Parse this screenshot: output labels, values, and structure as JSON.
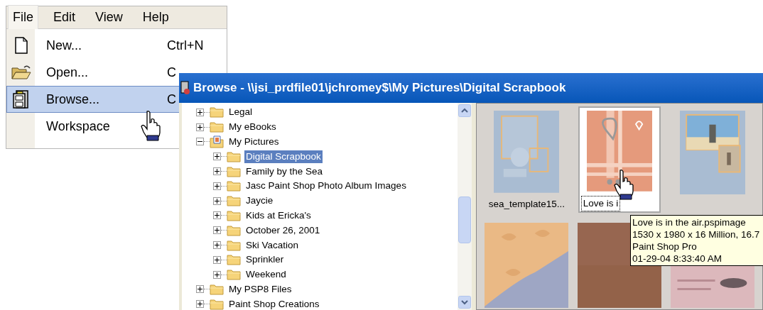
{
  "menu_bar": [
    {
      "label": "File",
      "selected": true
    },
    {
      "label": "Edit",
      "selected": false
    },
    {
      "label": "View",
      "selected": false
    },
    {
      "label": "Help",
      "selected": false
    }
  ],
  "menu_items": [
    {
      "label": "New...",
      "shortcut": "Ctrl+N",
      "selected": false
    },
    {
      "label": "Open...",
      "shortcut": "C",
      "selected": false
    },
    {
      "label": "Browse...",
      "shortcut": "C",
      "selected": true
    },
    {
      "label": "Workspace",
      "selected": false
    }
  ],
  "window": {
    "title": "Browse - \\\\jsi_prdfile01\\jchromey$\\My Pictures\\Digital Scrapbook"
  },
  "tree": [
    {
      "label": "Legal",
      "kind": "folder",
      "expanded": false,
      "selected": false
    },
    {
      "label": "My eBooks",
      "kind": "folder",
      "expanded": false,
      "selected": false
    },
    {
      "label": "My Pictures",
      "kind": "pictures",
      "expanded": true,
      "selected": false,
      "children": [
        {
          "label": "Digital Scrapbook",
          "kind": "folder",
          "expanded": false,
          "selected": true
        },
        {
          "label": "Family by the Sea",
          "kind": "folder",
          "expanded": false,
          "selected": false
        },
        {
          "label": "Jasc Paint Shop Photo Album Images",
          "kind": "folder",
          "expanded": false,
          "selected": false
        },
        {
          "label": "Jaycie",
          "kind": "folder",
          "expanded": false,
          "selected": false
        },
        {
          "label": "Kids at Ericka's",
          "kind": "folder",
          "expanded": false,
          "selected": false
        },
        {
          "label": "October 26, 2001",
          "kind": "folder",
          "expanded": false,
          "selected": false
        },
        {
          "label": "Ski Vacation",
          "kind": "folder",
          "expanded": false,
          "selected": false
        },
        {
          "label": "Sprinkler",
          "kind": "folder",
          "expanded": false,
          "selected": false
        },
        {
          "label": "Weekend",
          "kind": "folder",
          "expanded": false,
          "selected": false
        }
      ]
    },
    {
      "label": "My PSP8 Files",
      "kind": "folder",
      "expanded": false,
      "selected": false
    },
    {
      "label": "Paint Shop Creations",
      "kind": "folder",
      "expanded": false,
      "selected": false
    }
  ],
  "thumbnails": [
    {
      "label": "sea_template15...",
      "selected": false,
      "kind": "template"
    },
    {
      "label": "Love is i",
      "selected": true,
      "kind": "love"
    },
    {
      "selected": false,
      "kind": "beach"
    },
    {
      "selected": false,
      "kind": "leaves"
    },
    {
      "selected": false,
      "kind": "brown"
    },
    {
      "selected": false,
      "kind": "pink"
    }
  ],
  "tooltip": {
    "lines": [
      "Love is in the air.pspimage",
      "1530 x 1980 x 16 Million, 16.7",
      "Paint Shop Pro",
      "01-29-04 8:33:40 AM"
    ]
  }
}
